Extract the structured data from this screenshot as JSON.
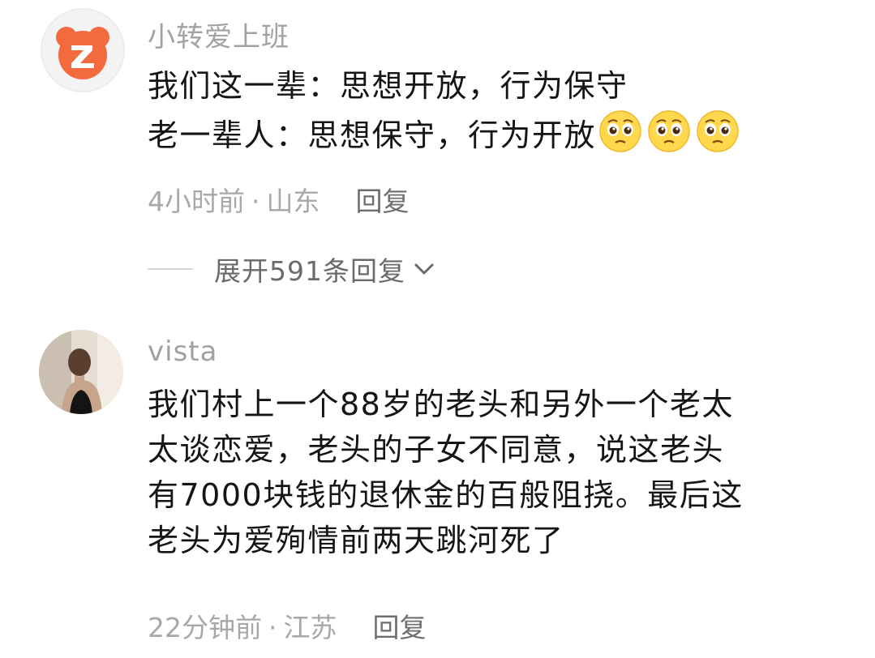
{
  "comments": [
    {
      "username": "小转爱上班",
      "avatar_icon": "zhuanzhuan-logo-icon",
      "lines": [
        "我们这一辈：思想开放，行为保守",
        "老一辈人：思想保守，行为开放"
      ],
      "emojis": [
        "pleading-face-emoji",
        "pleading-face-emoji",
        "pleading-face-emoji"
      ],
      "time": "4小时前",
      "location": "山东",
      "reply_label": "回复"
    },
    {
      "username": "vista",
      "avatar_icon": "user-photo-avatar",
      "lines": [
        "我们村上一个88岁的老头和另外一个老太",
        "太谈恋爱，老头的子女不同意，说这老头",
        "有7000块钱的退休金的百般阻挠。最后这",
        "老头为爱殉情前两天跳河死了"
      ],
      "time": "22分钟前",
      "location": "江苏",
      "reply_label": "回复"
    }
  ],
  "expand_replies": {
    "label": "展开591条回复",
    "icon": "chevron-down-icon"
  },
  "separator": "·",
  "colors": {
    "username": "#a2a2a2",
    "body": "#151515",
    "meta": "#a8a8a8",
    "brand_orange": "#f26a3d"
  }
}
